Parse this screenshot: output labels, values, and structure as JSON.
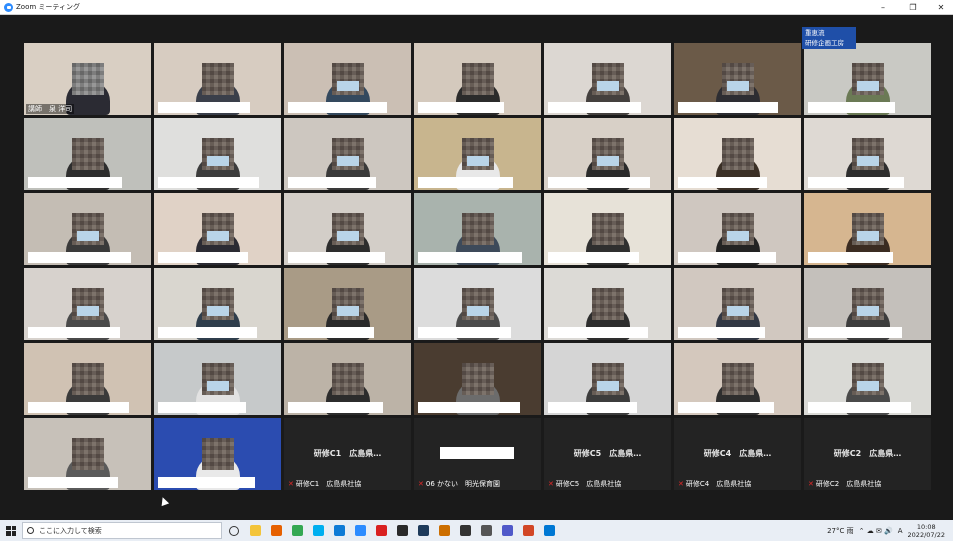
{
  "window": {
    "title": "Zoom ミーティング",
    "controls": [
      "–",
      "❐",
      "✕"
    ]
  },
  "overlay_badge": "重恵流\n研修企画工房",
  "tiles": [
    {
      "label": "講師　泉 洋司",
      "active": true,
      "wall": "#d9cfc3",
      "shirt": "#2b2b33",
      "hair": "#8a8a8a",
      "mask": false,
      "host": true
    },
    {
      "wall": "#d7ccc1",
      "shirt": "#3a3f4a",
      "mask": false
    },
    {
      "wall": "#cbbfb4",
      "shirt": "#34495e",
      "mask": true
    },
    {
      "wall": "#d4c9bd",
      "shirt": "#2b2b2b",
      "mask": false
    },
    {
      "wall": "#dcd7d2",
      "shirt": "#44403e",
      "mask": true
    },
    {
      "wall": "#6b5a48",
      "shirt": "#2d2d32",
      "mask": true
    },
    {
      "wall": "#c9c9c4",
      "shirt": "#6b7a55",
      "mask": true
    },
    {
      "wall": "#bfc0bb",
      "shirt": "#2e2e2e",
      "mask": false
    },
    {
      "wall": "#dfdfdd",
      "shirt": "#3c3c3c",
      "mask": true
    },
    {
      "wall": "#cdc7c0",
      "shirt": "#3a3a3a",
      "mask": true
    },
    {
      "wall": "#c8b58e",
      "shirt": "#e8e8e8",
      "mask": true
    },
    {
      "wall": "#d8d0c7",
      "shirt": "#2b2b2b",
      "mask": true
    },
    {
      "wall": "#e6ddd3",
      "shirt": "#3b3026",
      "mask": false
    },
    {
      "wall": "#ded9d3",
      "shirt": "#2e2e2e",
      "mask": true
    },
    {
      "wall": "#c4bdb4",
      "shirt": "#3a3a3a",
      "mask": true
    },
    {
      "wall": "#e0d2c6",
      "shirt": "#2b2b33",
      "mask": true
    },
    {
      "wall": "#d3cec8",
      "shirt": "#2d2d2d",
      "mask": true
    },
    {
      "wall": "#a9b3ad",
      "shirt": "#3d4a5a",
      "mask": false
    },
    {
      "wall": "#e7e2d8",
      "shirt": "#2f2f2f",
      "mask": false
    },
    {
      "wall": "#cfc7c0",
      "shirt": "#232323",
      "mask": true
    },
    {
      "wall": "#d6b690",
      "shirt": "#3b2c22",
      "mask": true
    },
    {
      "wall": "#d7d2cd",
      "shirt": "#4a4a4a",
      "mask": true
    },
    {
      "wall": "#d9d6cf",
      "shirt": "#2f3e4c",
      "mask": true
    },
    {
      "wall": "#a99b86",
      "shirt": "#2a2a2a",
      "mask": true
    },
    {
      "wall": "#dcdcdc",
      "shirt": "#4b4b4b",
      "mask": true
    },
    {
      "wall": "#dcdad6",
      "shirt": "#2e2e2e",
      "mask": false
    },
    {
      "wall": "#d1c8c0",
      "shirt": "#323844",
      "mask": true
    },
    {
      "wall": "#c4c0bb",
      "shirt": "#3d3d3d",
      "mask": true
    },
    {
      "wall": "#d0c2b3",
      "shirt": "#3a3a3a",
      "mask": false
    },
    {
      "wall": "#c6c9ca",
      "shirt": "#e2e2e2",
      "mask": true
    },
    {
      "wall": "#bcb3a7",
      "shirt": "#2c2c2c",
      "mask": false
    },
    {
      "wall": "#4a3c30",
      "shirt": "#6c6c6c",
      "mask": false
    },
    {
      "wall": "#d5d5d5",
      "shirt": "#3c3c3c",
      "mask": true
    },
    {
      "wall": "#d4c8bd",
      "shirt": "#2e2e2e",
      "mask": false
    },
    {
      "wall": "#dadad6",
      "shirt": "#4a4a4a",
      "mask": true
    },
    {
      "wall": "#c7c1b9",
      "shirt": "#5a5a5a",
      "mask": false
    },
    {
      "wall": "#2b4cb0",
      "shirt": "#e9e9e9",
      "mask": false
    },
    {
      "dark": true,
      "center": "研修C1　広島県…",
      "label": "研修C1　広島県社協"
    },
    {
      "dark": true,
      "center": "",
      "label": "06 かない　明光保育園",
      "redact_center": true
    },
    {
      "dark": true,
      "center": "研修C5　広島県…",
      "label": "研修C5　広島県社協"
    },
    {
      "dark": true,
      "center": "研修C4　広島県…",
      "label": "研修C4　広島県社協"
    },
    {
      "dark": true,
      "center": "研修C2　広島県…",
      "label": "研修C2　広島県社協"
    }
  ],
  "taskbar": {
    "search_placeholder": "ここに入力して検索",
    "apps": [
      {
        "name": "task-view-icon",
        "color": "#333"
      },
      {
        "name": "explorer-icon",
        "color": "#f3c43a"
      },
      {
        "name": "firefox-icon",
        "color": "#e66000"
      },
      {
        "name": "chrome-icon",
        "color": "#34a853"
      },
      {
        "name": "skype-icon",
        "color": "#00aff0"
      },
      {
        "name": "edge-icon",
        "color": "#0f7bd6"
      },
      {
        "name": "zoom-icon",
        "color": "#2d8cff"
      },
      {
        "name": "record-icon",
        "color": "#d92020"
      },
      {
        "name": "obs-icon",
        "color": "#2a2a2a"
      },
      {
        "name": "terminal-icon",
        "color": "#1e3a5a"
      },
      {
        "name": "illustrator-icon",
        "color": "#cc6e00"
      },
      {
        "name": "app-icon",
        "color": "#333"
      },
      {
        "name": "camera-icon",
        "color": "#555"
      },
      {
        "name": "teams-icon",
        "color": "#5059c9"
      },
      {
        "name": "powerpoint-icon",
        "color": "#d24726"
      },
      {
        "name": "photos-icon",
        "color": "#0078d4"
      }
    ],
    "weather": "27°C 雨",
    "ime": "A",
    "time": "10:08",
    "date": "2022/07/22"
  }
}
